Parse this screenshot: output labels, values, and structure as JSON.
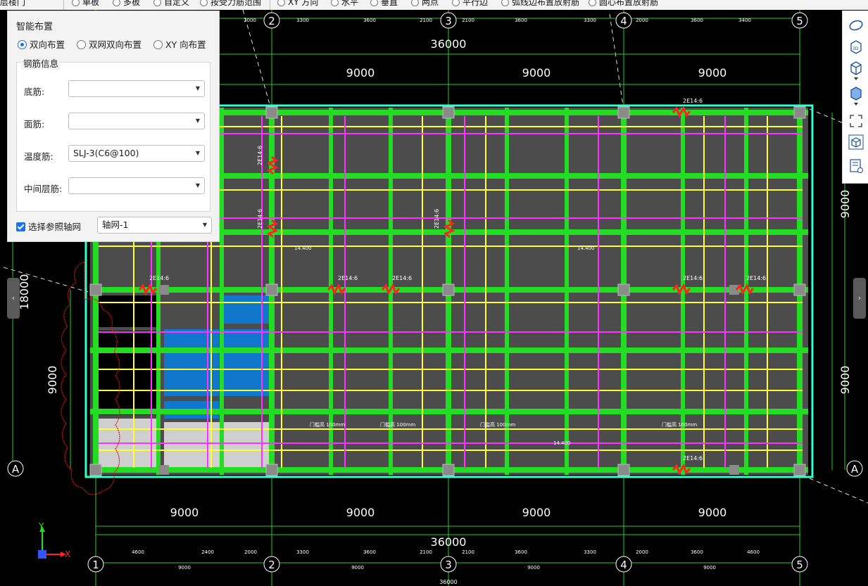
{
  "toolbar": {
    "items": [
      {
        "label": "层楼门"
      },
      {
        "label": "单板"
      },
      {
        "label": "多板"
      },
      {
        "label": "自定义"
      },
      {
        "label": "按受力筋范围"
      },
      {
        "label": "XY 方向"
      },
      {
        "label": "水平"
      },
      {
        "label": "垂直"
      },
      {
        "label": "两点"
      },
      {
        "label": "平行边"
      },
      {
        "label": "弧线边布置放射筋"
      },
      {
        "label": "圆心布置放射筋"
      }
    ]
  },
  "panel": {
    "title": "智能布置",
    "layout_options": [
      "双向布置",
      "双网双向布置",
      "XY 向布置"
    ],
    "selected_option": "双向布置",
    "group_title": "钢筋信息",
    "fields": [
      {
        "label": "底筋:",
        "value": ""
      },
      {
        "label": "面筋:",
        "value": ""
      },
      {
        "label": "温度筋:",
        "value": "SLJ-3(C6@100)"
      },
      {
        "label": "中间层筋:",
        "value": ""
      }
    ],
    "ref_grid_label": "选择参照轴网",
    "ref_grid_checked": true,
    "ref_grid_value": "轴网-1"
  },
  "drawing": {
    "total_dim": "36000",
    "bay_dims": [
      "9000",
      "9000",
      "9000",
      "9000"
    ],
    "right_dim_top": "9000",
    "right_dim_bottom": "9000",
    "left_dim_total": "18000",
    "left_dim_bottom": "9000",
    "axis_numbers": [
      "1",
      "2",
      "3",
      "4",
      "5"
    ],
    "axis_letter": "A",
    "top_sub_dims": [
      "2000",
      "3300",
      "3600",
      "2100",
      "2100",
      "3600",
      "3300",
      "2000",
      "3600",
      "3400"
    ],
    "bottom_sub_dims": [
      "4600",
      "2400",
      "2000",
      "3300",
      "3600",
      "2100",
      "2100",
      "3600",
      "3300",
      "2000",
      "3600",
      "4600"
    ],
    "bottom_small_dims": [
      "9000",
      "9000",
      "9000",
      "9000"
    ],
    "bottom_total_small": "36000",
    "rebar_tag": "2E14:6",
    "door_note": "门槛高 100mm",
    "elevation_note": "14.400",
    "axes_labels": {
      "y": "Y",
      "x": "X"
    }
  },
  "right_toolbar": {
    "buttons": [
      "ellipse-icon",
      "view-3d-icon",
      "cube-wire-icon",
      "cube-solid-icon",
      "fit-view-icon",
      "isometric-cube-icon",
      "properties-icon"
    ]
  },
  "colors": {
    "slab_fill": "#4c4c4c",
    "beam_green": "#22dd22",
    "rebar_yellow": "#ffff33",
    "rebar_magenta": "#ff33ff",
    "room_blue": "#1177cc",
    "background": "#000000"
  }
}
